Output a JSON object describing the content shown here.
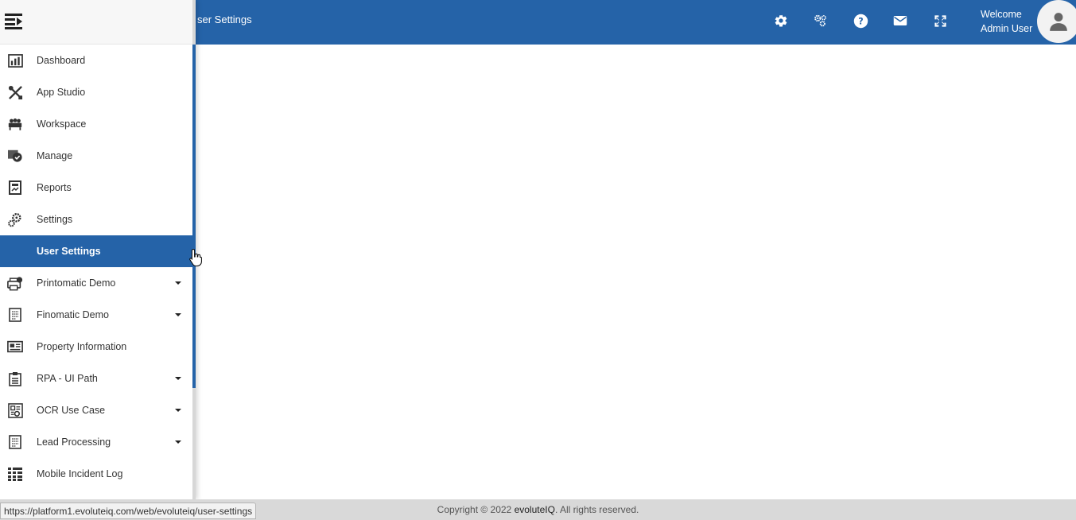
{
  "header": {
    "breadcrumb": "ser Settings",
    "welcome_line1": "Welcome",
    "welcome_line2": "Admin User",
    "icons": [
      "gear-icon",
      "cogs-icon",
      "help-icon",
      "mail-icon",
      "fullscreen-icon"
    ]
  },
  "sidebar": {
    "items": [
      {
        "label": "Dashboard",
        "icon": "dashboard-icon",
        "caret": false
      },
      {
        "label": "App Studio",
        "icon": "tools-icon",
        "caret": false
      },
      {
        "label": "Workspace",
        "icon": "workspace-icon",
        "caret": false
      },
      {
        "label": "Manage",
        "icon": "manage-icon",
        "caret": false
      },
      {
        "label": "Reports",
        "icon": "reports-icon",
        "caret": false
      },
      {
        "label": "Settings",
        "icon": "settings-icon",
        "caret": false
      },
      {
        "label": "User Settings",
        "icon": "",
        "caret": false,
        "active": true
      },
      {
        "label": "Printomatic Demo",
        "icon": "printer-icon",
        "caret": true
      },
      {
        "label": "Finomatic Demo",
        "icon": "document-icon",
        "caret": true
      },
      {
        "label": "Property Information",
        "icon": "property-icon",
        "caret": false
      },
      {
        "label": "RPA - UI Path",
        "icon": "clipboard-icon",
        "caret": true
      },
      {
        "label": "OCR Use Case",
        "icon": "ocr-icon",
        "caret": true
      },
      {
        "label": "Lead Processing",
        "icon": "document-icon",
        "caret": true
      },
      {
        "label": "Mobile Incident Log",
        "icon": "grid-icon",
        "caret": false
      }
    ]
  },
  "footer": {
    "copyright_prefix": "Copyright © 2022 ",
    "brand": "evoluteIQ",
    "copyright_suffix": ". All rights reserved.",
    "status_url": "https://platform1.evoluteiq.com/web/evoluteiq/user-settings"
  },
  "colors": {
    "primary": "#2563a8",
    "footer_bg": "#d9d9d9"
  }
}
